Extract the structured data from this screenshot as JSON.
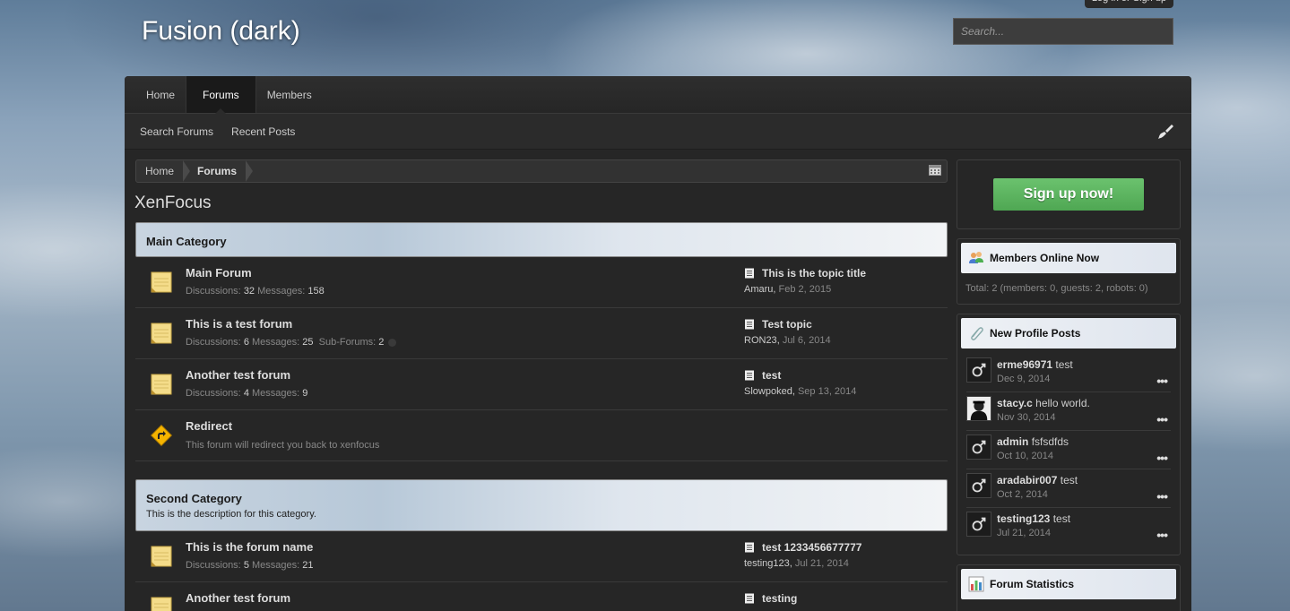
{
  "site": {
    "title": "Fusion (dark)",
    "login_label": "Log in or Sign up",
    "search_placeholder": "Search..."
  },
  "nav": {
    "tabs": [
      {
        "label": "Home",
        "active": false
      },
      {
        "label": "Forums",
        "active": true
      },
      {
        "label": "Members",
        "active": false
      }
    ],
    "sub_links": [
      "Search Forums",
      "Recent Posts"
    ]
  },
  "breadcrumb": [
    "Home",
    "Forums"
  ],
  "page_title": "XenFocus",
  "categories": [
    {
      "title": "Main Category",
      "description": ""
    },
    {
      "title": "Second Category",
      "description": "This is the description for this category."
    }
  ],
  "forums": [
    {
      "name": "Main Forum",
      "discussions": "32",
      "messages": "158",
      "last_title": "This is the topic title",
      "last_user": "Amaru",
      "last_date": "Feb 2, 2015"
    },
    {
      "name": "This is a test forum",
      "discussions": "6",
      "messages": "25",
      "subforums": "2",
      "last_title": "Test topic",
      "last_user": "RON23",
      "last_date": "Jul 6, 2014"
    },
    {
      "name": "Another test forum",
      "discussions": "4",
      "messages": "9",
      "last_title": "test",
      "last_user": "Slowpoked",
      "last_date": "Sep 13, 2014"
    },
    {
      "name": "Redirect",
      "description": "This forum will redirect you back to xenfocus"
    },
    {
      "name": "This is the forum name",
      "discussions": "5",
      "messages": "21",
      "last_title": "test 1233456677777",
      "last_user": "testing123",
      "last_date": "Jul 21, 2014"
    },
    {
      "name": "Another test forum",
      "last_title": "testing"
    }
  ],
  "labels": {
    "discussions": "Discussions:",
    "messages": "Messages:",
    "subforums": "Sub-Forums:"
  },
  "sidebar": {
    "signup_label": "Sign up now!",
    "members_online": {
      "title": "Members Online Now",
      "summary": "Total: 2 (members: 0, guests: 2, robots: 0)"
    },
    "profile_posts": {
      "title": "New Profile Posts",
      "items": [
        {
          "user": "erme96971",
          "text": "test",
          "date": "Dec 9, 2014"
        },
        {
          "user": "stacy.c",
          "text": "hello world.",
          "date": "Nov 30, 2014"
        },
        {
          "user": "admin",
          "text": "fsfsdfds",
          "date": "Oct 10, 2014"
        },
        {
          "user": "aradabir007",
          "text": "test",
          "date": "Oct 2, 2014"
        },
        {
          "user": "testing123",
          "text": "test",
          "date": "Jul 21, 2014"
        }
      ],
      "more_label": "•••"
    },
    "forum_statistics": {
      "title": "Forum Statistics"
    }
  },
  "icons": {
    "brush": "paint-brush-icon",
    "calendar": "calendar-icon",
    "forum": "forum-notepad-icon",
    "redirect": "redirect-sign-icon",
    "doc": "document-icon",
    "members": "members-icon",
    "profile": "paperclip-icon",
    "stats": "bar-chart-icon",
    "avatar": "male-avatar-icon"
  },
  "colors": {
    "accent_green": "#5cb85f",
    "panel_dark": "#262626",
    "category_header": "#c8d4e0"
  }
}
